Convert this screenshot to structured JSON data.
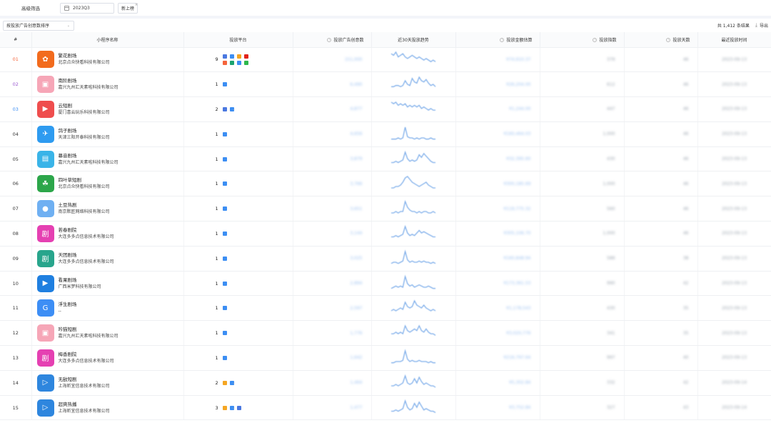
{
  "filter": {
    "label": "高级筛选",
    "date_value": "2023Q3",
    "tag_label": "新上榜"
  },
  "toolbar": {
    "sort_label": "按投放广告创意数排序",
    "total_text": "共 1,412 条结果",
    "export_label": "导出"
  },
  "columns": {
    "index": "#",
    "app": "小程序名称",
    "platform": "投放平台",
    "creatives": "投放广告创意数",
    "trend": "近30天投放趋势",
    "spend": "投放金额估算",
    "heat": "投放指数",
    "days": "投放天数",
    "last": "最近投放时间"
  },
  "colors": {
    "rank1": "#f5643b",
    "rank2": "#9b59d0",
    "rank3": "#3c8ef3",
    "trend_line": "#7eaeea"
  },
  "rows": [
    {
      "rank": "01",
      "name": "繁花剧场",
      "company": "北京点众快看科技有限公司",
      "platform_count": "9",
      "icon_color": "#f26b1d",
      "icon_glyph": "✿",
      "platforms": [
        "#4a78e0",
        "#3c8ef3",
        "#f5a623",
        "#e2231a",
        "#f5643b",
        "#1aa36f",
        "#3c8ef3",
        "#2db84d"
      ],
      "creatives": "151,000",
      "spend": "¥74,910.37",
      "heat": "379",
      "days": "46",
      "last": "2023-09-13",
      "trend": [
        8,
        7,
        9,
        6,
        7,
        8,
        6,
        5,
        6,
        7,
        6,
        5,
        6,
        5,
        4,
        5,
        4,
        3,
        4,
        3
      ]
    },
    {
      "rank": "02",
      "name": "南阶剧场",
      "company": "嘉兴九州汇天素啦科技有限公司",
      "platform_count": "1",
      "icon_color": "#f6a6b7",
      "icon_glyph": "▣",
      "platforms": [
        "#3c8ef3"
      ],
      "creatives": "6,490",
      "spend": "¥26,204.00",
      "heat": "612",
      "days": "46",
      "last": "2023-09-13",
      "trend": [
        4,
        4,
        5,
        5,
        4,
        5,
        9,
        6,
        5,
        11,
        8,
        7,
        12,
        9,
        8,
        10,
        7,
        5,
        6,
        4
      ]
    },
    {
      "rank": "03",
      "name": "云短剧",
      "company": "厦门喜云玩乐科技有限公司",
      "platform_count": "2",
      "icon_color": "#ef4e4e",
      "icon_glyph": "▶",
      "platforms": [
        "#4a78e0",
        "#3c8ef3"
      ],
      "creatives": "4,877",
      "spend": "¥1,244.00",
      "heat": "447",
      "days": "46",
      "last": "2023-09-13",
      "trend": [
        9,
        8,
        9,
        7,
        8,
        7,
        8,
        6,
        7,
        6,
        7,
        6,
        7,
        5,
        6,
        5,
        4,
        5,
        4,
        4
      ]
    },
    {
      "rank": "04",
      "name": "鸽子剧场",
      "company": "天津三阳开泰科技有限公司",
      "platform_count": "1",
      "icon_color": "#2e9bf0",
      "icon_glyph": "✈",
      "platforms": [
        "#3c8ef3"
      ],
      "creatives": "4,656",
      "spend": "¥160,464.03",
      "heat": "1,000",
      "days": "46",
      "last": "2023-09-13",
      "trend": [
        2,
        2,
        2,
        3,
        2,
        3,
        12,
        4,
        3,
        3,
        2,
        3,
        2,
        3,
        3,
        2,
        2,
        3,
        2,
        2
      ]
    },
    {
      "rank": "05",
      "name": "幕音剧场",
      "company": "嘉兴九州汇天素啦科技有限公司",
      "platform_count": "1",
      "icon_color": "#3ab4e8",
      "icon_glyph": "▤",
      "platforms": [
        "#3c8ef3"
      ],
      "creatives": "3,879",
      "spend": "¥32,395.60",
      "heat": "430",
      "days": "46",
      "last": "2023-09-13",
      "trend": [
        3,
        3,
        4,
        3,
        4,
        5,
        11,
        6,
        4,
        5,
        4,
        5,
        9,
        7,
        10,
        8,
        6,
        4,
        3,
        3
      ]
    },
    {
      "rank": "06",
      "name": "四叶草短剧",
      "company": "北京点众快看科技有限公司",
      "platform_count": "1",
      "icon_color": "#2ca64a",
      "icon_glyph": "☘",
      "platforms": [
        "#3c8ef3"
      ],
      "creatives": "3,766",
      "spend": "¥300,185.69",
      "heat": "1,000",
      "days": "46",
      "last": "2023-09-13",
      "trend": [
        2,
        2,
        3,
        3,
        4,
        6,
        9,
        10,
        8,
        6,
        5,
        4,
        3,
        4,
        5,
        6,
        4,
        3,
        2,
        2
      ]
    },
    {
      "rank": "07",
      "name": "土豆热剧",
      "company": "南京默匠网络科技有限公司",
      "platform_count": "1",
      "icon_color": "#6fb0f2",
      "icon_glyph": "●",
      "platforms": [
        "#3c8ef3"
      ],
      "creatives": "3,651",
      "spend": "¥119,775.32",
      "heat": "560",
      "days": "46",
      "last": "2023-09-13",
      "trend": [
        2,
        2,
        3,
        2,
        3,
        3,
        10,
        6,
        4,
        3,
        3,
        2,
        3,
        2,
        3,
        3,
        2,
        2,
        3,
        2
      ]
    },
    {
      "rank": "08",
      "name": "若春剧院",
      "company": "大连多多点信息技术有限公司",
      "platform_count": "1",
      "icon_color": "#e540b2",
      "icon_glyph": "剧",
      "platforms": [
        "#3c8ef3"
      ],
      "creatives": "3,144",
      "spend": "¥305,106.70",
      "heat": "1,000",
      "days": "46",
      "last": "2023-09-13",
      "trend": [
        3,
        3,
        4,
        3,
        4,
        5,
        11,
        6,
        4,
        5,
        4,
        6,
        8,
        6,
        7,
        6,
        5,
        4,
        3,
        3
      ]
    },
    {
      "rank": "09",
      "name": "天团剧场",
      "company": "大连多多点信息技术有限公司",
      "platform_count": "1",
      "icon_color": "#28a58c",
      "icon_glyph": "剧",
      "platforms": [
        "#3c8ef3"
      ],
      "creatives": "3,025",
      "spend": "¥160,848.94",
      "heat": "589",
      "days": "38",
      "last": "2023-09-13",
      "trend": [
        2,
        3,
        3,
        2,
        3,
        4,
        12,
        5,
        3,
        4,
        3,
        3,
        4,
        3,
        4,
        3,
        3,
        2,
        3,
        2
      ]
    },
    {
      "rank": "10",
      "name": "看果剧场",
      "company": "广西米梦科技有限公司",
      "platform_count": "1",
      "icon_color": "#1f7fe0",
      "icon_glyph": "▶",
      "platforms": [
        "#3c8ef3"
      ],
      "creatives": "2,894",
      "spend": "¥173,361.53",
      "heat": "990",
      "days": "42",
      "last": "2023-09-13",
      "trend": [
        2,
        3,
        4,
        3,
        4,
        3,
        12,
        6,
        4,
        5,
        3,
        4,
        5,
        4,
        3,
        3,
        4,
        3,
        2,
        2
      ]
    },
    {
      "rank": "11",
      "name": "浮生剧场",
      "company": "--",
      "platform_count": "1",
      "icon_color": "#3d8ef5",
      "icon_glyph": "G",
      "platforms": [
        "#3c8ef3"
      ],
      "creatives": "2,597",
      "spend": "¥1,178,543",
      "heat": "430",
      "days": "35",
      "last": "2023-09-13",
      "trend": [
        3,
        4,
        3,
        4,
        5,
        4,
        9,
        6,
        5,
        6,
        10,
        7,
        6,
        5,
        7,
        5,
        4,
        3,
        4,
        3
      ]
    },
    {
      "rank": "12",
      "name": "吟猫短剧",
      "company": "嘉兴九州汇天素啦科技有限公司",
      "platform_count": "1",
      "icon_color": "#f6a6b7",
      "icon_glyph": "▣",
      "platforms": [
        "#3c8ef3"
      ],
      "creatives": "1,776",
      "spend": "¥3,020,776",
      "heat": "341",
      "days": "35",
      "last": "2023-09-13",
      "trend": [
        4,
        4,
        5,
        4,
        5,
        4,
        9,
        6,
        5,
        6,
        7,
        6,
        9,
        6,
        5,
        7,
        5,
        4,
        4,
        3
      ]
    },
    {
      "rank": "13",
      "name": "梅香剧院",
      "company": "大连多多点信息技术有限公司",
      "platform_count": "1",
      "icon_color": "#e540b2",
      "icon_glyph": "剧",
      "platforms": [
        "#3c8ef3"
      ],
      "creatives": "1,642",
      "spend": "¥216,797.64",
      "heat": "997",
      "days": "40",
      "last": "2023-09-13",
      "trend": [
        2,
        2,
        3,
        3,
        3,
        4,
        12,
        5,
        3,
        4,
        3,
        3,
        4,
        3,
        3,
        3,
        2,
        3,
        2,
        2
      ]
    },
    {
      "rank": "14",
      "name": "无敌短剧",
      "company": "上海昕宜信息技术有限公司",
      "platform_count": "2",
      "icon_color": "#2e86de",
      "icon_glyph": "▷",
      "platforms": [
        "#f5a623",
        "#3c8ef3"
      ],
      "creatives": "1,464",
      "spend": "¥5,302.84",
      "heat": "332",
      "days": "42",
      "last": "2023-09-14",
      "trend": [
        3,
        3,
        4,
        3,
        4,
        5,
        10,
        5,
        4,
        5,
        8,
        5,
        9,
        6,
        4,
        5,
        4,
        3,
        3,
        2
      ]
    },
    {
      "rank": "15",
      "name": "超爽热播",
      "company": "上海昕宜信息技术有限公司",
      "platform_count": "3",
      "icon_color": "#2e86de",
      "icon_glyph": "▷",
      "platforms": [
        "#f5a623",
        "#3c8ef3",
        "#4a78e0"
      ],
      "creatives": "1,477",
      "spend": "¥3,752.84",
      "heat": "327",
      "days": "43",
      "last": "2023-09-14",
      "trend": [
        3,
        3,
        4,
        3,
        4,
        5,
        11,
        6,
        4,
        5,
        9,
        6,
        10,
        7,
        4,
        5,
        4,
        3,
        3,
        2
      ]
    }
  ]
}
